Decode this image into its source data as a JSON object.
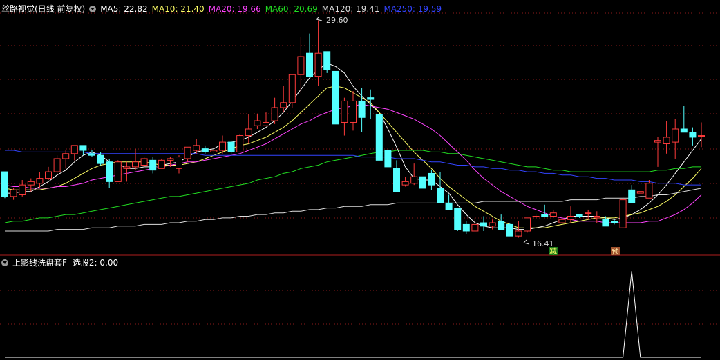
{
  "main_title": "丝路视觉(日线 前复权)",
  "ma_labels": [
    {
      "text": "MA5: 22.82",
      "color": "#ffffff"
    },
    {
      "text": "MA10: 21.40",
      "color": "#ffff66"
    },
    {
      "text": "MA20: 19.66",
      "color": "#ff44ff"
    },
    {
      "text": "MA60: 20.69",
      "color": "#22dd22"
    },
    {
      "text": "MA120: 19.41",
      "color": "#dddddd"
    },
    {
      "text": "MA250: 19.59",
      "color": "#3344ff"
    }
  ],
  "indicator_title": "上影线洗盘套F",
  "indicator_value": "选股2: 0.00",
  "annotations": {
    "high_label": "29.60",
    "low_label": "16.41",
    "tag_sell": "减",
    "tag_pre": "预"
  },
  "colors": {
    "up": "#ff3b3b",
    "down": "#54ffff",
    "grid": "#8b1a1a",
    "ma5": "#ffffff",
    "ma10": "#ffff66",
    "ma20": "#ff44ff",
    "ma60": "#22dd22",
    "ma120": "#dddddd",
    "ma250": "#3344ff"
  },
  "chart_data": [
    {
      "type": "candlestick",
      "title": "丝路视觉(日线 前复权)",
      "ylim": [
        15.5,
        30.5
      ],
      "ohlc": [
        [
          20.4,
          20.4,
          18.8,
          18.9
        ],
        [
          18.9,
          19.4,
          18.7,
          19.3
        ],
        [
          19.0,
          19.9,
          18.9,
          19.6
        ],
        [
          19.6,
          20.0,
          19.2,
          19.8
        ],
        [
          19.7,
          20.4,
          19.4,
          20.0
        ],
        [
          20.0,
          20.7,
          19.9,
          20.4
        ],
        [
          20.4,
          21.4,
          20.2,
          21.2
        ],
        [
          21.2,
          21.7,
          20.6,
          21.5
        ],
        [
          21.5,
          22.0,
          21.1,
          22.0
        ],
        [
          22.0,
          22.0,
          21.4,
          21.7
        ],
        [
          21.5,
          21.7,
          21.3,
          21.4
        ],
        [
          21.4,
          21.6,
          20.8,
          20.9
        ],
        [
          21.0,
          21.2,
          19.4,
          19.8
        ],
        [
          19.8,
          21.1,
          19.8,
          21.0
        ],
        [
          20.6,
          21.0,
          19.8,
          20.7
        ],
        [
          20.7,
          21.8,
          20.5,
          21.0
        ],
        [
          20.8,
          21.3,
          20.7,
          21.2
        ],
        [
          21.1,
          21.3,
          20.3,
          20.5
        ],
        [
          20.6,
          21.2,
          20.6,
          21.1
        ],
        [
          21.1,
          21.3,
          20.7,
          21.2
        ],
        [
          20.6,
          21.4,
          20.3,
          21.3
        ],
        [
          21.2,
          21.8,
          21.0,
          21.9
        ],
        [
          21.7,
          22.4,
          21.5,
          22.0
        ],
        [
          21.8,
          22.0,
          21.5,
          21.6
        ],
        [
          21.6,
          21.7,
          21.5,
          21.7
        ],
        [
          21.7,
          22.6,
          21.5,
          22.2
        ],
        [
          22.2,
          22.3,
          21.5,
          21.6
        ],
        [
          21.6,
          22.7,
          21.6,
          22.6
        ],
        [
          22.6,
          23.9,
          22.1,
          23.0
        ],
        [
          23.2,
          23.9,
          23.0,
          23.5
        ],
        [
          23.2,
          24.0,
          23.3,
          23.4
        ],
        [
          23.5,
          24.9,
          23.3,
          24.3
        ],
        [
          24.3,
          25.6,
          24.0,
          24.6
        ],
        [
          24.6,
          26.3,
          24.3,
          26.3
        ],
        [
          26.3,
          28.6,
          25.2,
          27.4
        ],
        [
          27.6,
          28.8,
          26.8,
          26.2
        ],
        [
          26.2,
          29.6,
          25.6,
          27.6
        ],
        [
          27.7,
          27.6,
          26.4,
          26.6
        ],
        [
          26.5,
          26.0,
          23.3,
          23.3
        ],
        [
          23.4,
          24.9,
          22.6,
          24.7
        ],
        [
          23.4,
          25.3,
          22.9,
          24.7
        ],
        [
          24.7,
          25.5,
          22.8,
          23.7
        ],
        [
          24.9,
          25.4,
          23.6,
          24.8
        ],
        [
          23.9,
          23.5,
          21.1,
          21.1
        ],
        [
          21.7,
          21.7,
          20.7,
          20.7
        ],
        [
          20.6,
          21.1,
          19.2,
          19.2
        ],
        [
          19.6,
          20.1,
          19.5,
          19.8
        ],
        [
          19.7,
          20.9,
          19.6,
          20.1
        ],
        [
          20.1,
          20.1,
          19.7,
          19.4
        ],
        [
          20.3,
          20.5,
          19.3,
          19.6
        ],
        [
          19.4,
          20.4,
          18.5,
          18.5
        ],
        [
          18.5,
          19.0,
          18.2,
          18.1
        ],
        [
          18.2,
          18.2,
          16.8,
          16.9
        ],
        [
          17.2,
          17.4,
          16.6,
          16.8
        ],
        [
          16.8,
          17.6,
          17.0,
          17.2
        ],
        [
          17.3,
          17.7,
          16.8,
          17.1
        ],
        [
          17.1,
          17.5,
          16.9,
          17.3
        ],
        [
          17.4,
          17.8,
          17.4,
          16.9
        ],
        [
          17.2,
          17.3,
          17.0,
          16.5
        ],
        [
          16.5,
          17.4,
          16.4,
          16.8
        ],
        [
          16.8,
          17.6,
          16.7,
          17.6
        ],
        [
          17.7,
          17.8,
          17.6,
          17.7
        ],
        [
          17.8,
          18.4,
          17.7,
          17.7
        ],
        [
          17.7,
          18.1,
          17.6,
          17.9
        ],
        [
          17.3,
          17.6,
          17.2,
          17.5
        ],
        [
          17.5,
          18.3,
          17.3,
          17.7
        ],
        [
          17.8,
          17.8,
          17.6,
          17.7
        ],
        [
          17.9,
          18.1,
          17.5,
          17.9
        ],
        [
          17.6,
          18.0,
          17.3,
          17.7
        ],
        [
          17.5,
          17.7,
          17.1,
          17.1
        ],
        [
          17.4,
          17.5,
          17.2,
          17.3
        ],
        [
          17.0,
          18.9,
          17.1,
          18.7
        ],
        [
          19.3,
          19.6,
          18.6,
          18.5
        ],
        [
          19.1,
          19.2,
          19.1,
          19.2
        ],
        [
          18.8,
          19.9,
          19.0,
          19.7
        ],
        [
          22.2,
          22.5,
          20.7,
          22.3
        ],
        [
          22.1,
          23.5,
          21.5,
          22.5
        ],
        [
          22.2,
          23.6,
          21.2,
          23.0
        ],
        [
          23.0,
          24.4,
          23.0,
          22.8
        ],
        [
          22.8,
          23.1,
          22.0,
          22.5
        ],
        [
          22.6,
          23.4,
          21.9,
          22.6
        ]
      ],
      "series": [
        {
          "name": "MA5",
          "values": [
            19.1,
            19.1,
            19.2,
            19.2,
            19.5,
            19.8,
            20.2,
            20.5,
            21.0,
            21.4,
            21.6,
            21.4,
            21.0,
            20.9,
            20.6,
            20.6,
            20.7,
            20.7,
            20.8,
            20.9,
            21.0,
            21.3,
            21.6,
            21.7,
            21.8,
            22.1,
            22.2,
            22.3,
            22.5,
            22.8,
            23.1,
            23.5,
            24.0,
            24.7,
            25.4,
            26.1,
            26.6,
            27.0,
            26.8,
            26.4,
            25.6,
            25.0,
            24.5,
            24.0,
            23.0,
            21.9,
            20.7,
            20.0,
            19.9,
            19.9,
            19.5,
            19.1,
            18.4,
            17.8,
            17.3,
            17.1,
            17.0,
            17.0,
            17.0,
            16.9,
            16.9,
            17.0,
            17.1,
            17.3,
            17.5,
            17.7,
            17.7,
            17.7,
            17.7,
            17.6,
            17.5,
            17.6,
            17.8,
            18.1,
            18.5,
            19.0,
            19.6,
            20.3,
            21.0,
            21.7,
            22.4
          ]
        },
        {
          "name": "MA10",
          "values": [
            19.4,
            19.3,
            19.3,
            19.3,
            19.3,
            19.4,
            19.5,
            19.7,
            20.0,
            20.3,
            20.6,
            20.8,
            20.9,
            21.0,
            21.0,
            21.0,
            21.0,
            20.9,
            20.8,
            20.8,
            20.8,
            20.9,
            21.0,
            21.2,
            21.4,
            21.6,
            21.8,
            22.0,
            22.1,
            22.3,
            22.5,
            22.8,
            23.1,
            23.5,
            24.0,
            24.5,
            25.0,
            25.5,
            25.6,
            25.5,
            25.2,
            24.9,
            24.6,
            24.0,
            23.4,
            22.8,
            22.2,
            21.6,
            21.1,
            20.6,
            20.0,
            19.5,
            19.1,
            18.7,
            18.3,
            18.0,
            17.7,
            17.4,
            17.2,
            17.0,
            17.0,
            17.0,
            17.0,
            17.1,
            17.2,
            17.3,
            17.4,
            17.5,
            17.6,
            17.6,
            17.6,
            17.7,
            17.8,
            17.9,
            18.1,
            18.3,
            18.6,
            19.0,
            19.5,
            20.0,
            20.6
          ]
        },
        {
          "name": "MA20",
          "values": [
            19.6,
            19.5,
            19.5,
            19.4,
            19.4,
            19.4,
            19.5,
            19.5,
            19.6,
            19.7,
            19.9,
            20.0,
            20.1,
            20.2,
            20.3,
            20.4,
            20.5,
            20.6,
            20.7,
            20.8,
            20.9,
            21.0,
            21.0,
            21.1,
            21.2,
            21.3,
            21.4,
            21.5,
            21.7,
            21.9,
            22.1,
            22.4,
            22.7,
            23.0,
            23.3,
            23.5,
            23.8,
            24.0,
            24.2,
            24.3,
            24.4,
            24.5,
            24.4,
            24.3,
            24.2,
            24.0,
            23.8,
            23.6,
            23.3,
            23.0,
            22.6,
            22.1,
            21.6,
            21.1,
            20.5,
            20.0,
            19.6,
            19.2,
            18.9,
            18.6,
            18.3,
            18.1,
            17.9,
            17.7,
            17.6,
            17.5,
            17.4,
            17.4,
            17.4,
            17.3,
            17.3,
            17.3,
            17.3,
            17.3,
            17.4,
            17.4,
            17.6,
            17.8,
            18.1,
            18.5,
            19.0
          ]
        },
        {
          "name": "MA60",
          "values": [
            17.3,
            17.4,
            17.4,
            17.5,
            17.6,
            17.6,
            17.7,
            17.8,
            17.8,
            17.9,
            18.0,
            18.1,
            18.2,
            18.3,
            18.4,
            18.5,
            18.6,
            18.7,
            18.8,
            18.9,
            18.9,
            19.0,
            19.1,
            19.2,
            19.3,
            19.4,
            19.5,
            19.6,
            19.7,
            19.9,
            20.0,
            20.1,
            20.3,
            20.4,
            20.6,
            20.7,
            20.8,
            21.0,
            21.1,
            21.2,
            21.3,
            21.4,
            21.5,
            21.6,
            21.6,
            21.7,
            21.7,
            21.7,
            21.7,
            21.6,
            21.6,
            21.5,
            21.5,
            21.4,
            21.3,
            21.2,
            21.1,
            21.0,
            20.9,
            20.8,
            20.7,
            20.7,
            20.6,
            20.5,
            20.5,
            20.4,
            20.4,
            20.4,
            20.4,
            20.4,
            20.4,
            20.4,
            20.4,
            20.4,
            20.4,
            20.5,
            20.5,
            20.6,
            20.6,
            20.7,
            20.7
          ]
        },
        {
          "name": "MA120",
          "values": [
            16.8,
            16.8,
            16.8,
            16.8,
            16.8,
            16.8,
            16.9,
            16.9,
            16.9,
            16.9,
            17.0,
            17.0,
            17.0,
            17.1,
            17.1,
            17.1,
            17.2,
            17.2,
            17.2,
            17.3,
            17.3,
            17.4,
            17.4,
            17.5,
            17.5,
            17.6,
            17.6,
            17.7,
            17.7,
            17.8,
            17.8,
            17.9,
            17.9,
            18.0,
            18.0,
            18.1,
            18.1,
            18.2,
            18.2,
            18.3,
            18.3,
            18.3,
            18.4,
            18.4,
            18.4,
            18.5,
            18.5,
            18.5,
            18.5,
            18.5,
            18.5,
            18.5,
            18.5,
            18.5,
            18.5,
            18.6,
            18.6,
            18.6,
            18.6,
            18.6,
            18.6,
            18.6,
            18.6,
            18.6,
            18.6,
            18.7,
            18.7,
            18.7,
            18.7,
            18.8,
            18.8,
            18.8,
            18.8,
            18.9,
            18.9,
            19.0,
            19.0,
            19.1,
            19.2,
            19.3,
            19.4
          ]
        },
        {
          "name": "MA250",
          "values": [
            21.7,
            21.7,
            21.6,
            21.6,
            21.6,
            21.6,
            21.6,
            21.6,
            21.6,
            21.6,
            21.5,
            21.5,
            21.5,
            21.5,
            21.5,
            21.5,
            21.5,
            21.5,
            21.5,
            21.5,
            21.5,
            21.5,
            21.5,
            21.4,
            21.4,
            21.4,
            21.4,
            21.4,
            21.4,
            21.4,
            21.4,
            21.4,
            21.4,
            21.4,
            21.4,
            21.4,
            21.4,
            21.4,
            21.4,
            21.4,
            21.4,
            21.3,
            21.3,
            21.3,
            21.3,
            21.2,
            21.2,
            21.2,
            21.1,
            21.0,
            21.0,
            20.9,
            20.8,
            20.8,
            20.7,
            20.7,
            20.6,
            20.6,
            20.5,
            20.5,
            20.4,
            20.4,
            20.3,
            20.3,
            20.2,
            20.2,
            20.1,
            20.1,
            20.0,
            20.0,
            19.9,
            19.9,
            19.9,
            19.8,
            19.8,
            19.7,
            19.7,
            19.7,
            19.6,
            19.6,
            19.6
          ]
        }
      ],
      "annotations": [
        {
          "text": "29.60",
          "index": 36,
          "value": 29.6
        },
        {
          "text": "16.41",
          "index": 58,
          "value": 16.41
        }
      ]
    },
    {
      "type": "line",
      "title": "上影线洗盘套F",
      "series": [
        {
          "name": "选股2",
          "values": [
            0,
            0,
            0,
            0,
            0,
            0,
            0,
            0,
            0,
            0,
            0,
            0,
            0,
            0,
            0,
            0,
            0,
            0,
            0,
            0,
            0,
            0,
            0,
            0,
            0,
            0,
            0,
            0,
            0,
            0,
            0,
            0,
            0,
            0,
            0,
            0,
            0,
            0,
            0,
            0,
            0,
            0,
            0,
            0,
            0,
            0,
            0,
            0,
            0,
            0,
            0,
            0,
            0,
            0,
            0,
            0,
            0,
            0,
            0,
            0,
            0,
            0,
            0,
            0,
            0,
            0,
            0,
            0,
            0,
            0,
            0,
            0,
            1,
            0,
            0,
            0,
            0,
            0,
            0,
            0,
            0
          ]
        }
      ],
      "ylim": [
        0,
        1
      ]
    }
  ]
}
